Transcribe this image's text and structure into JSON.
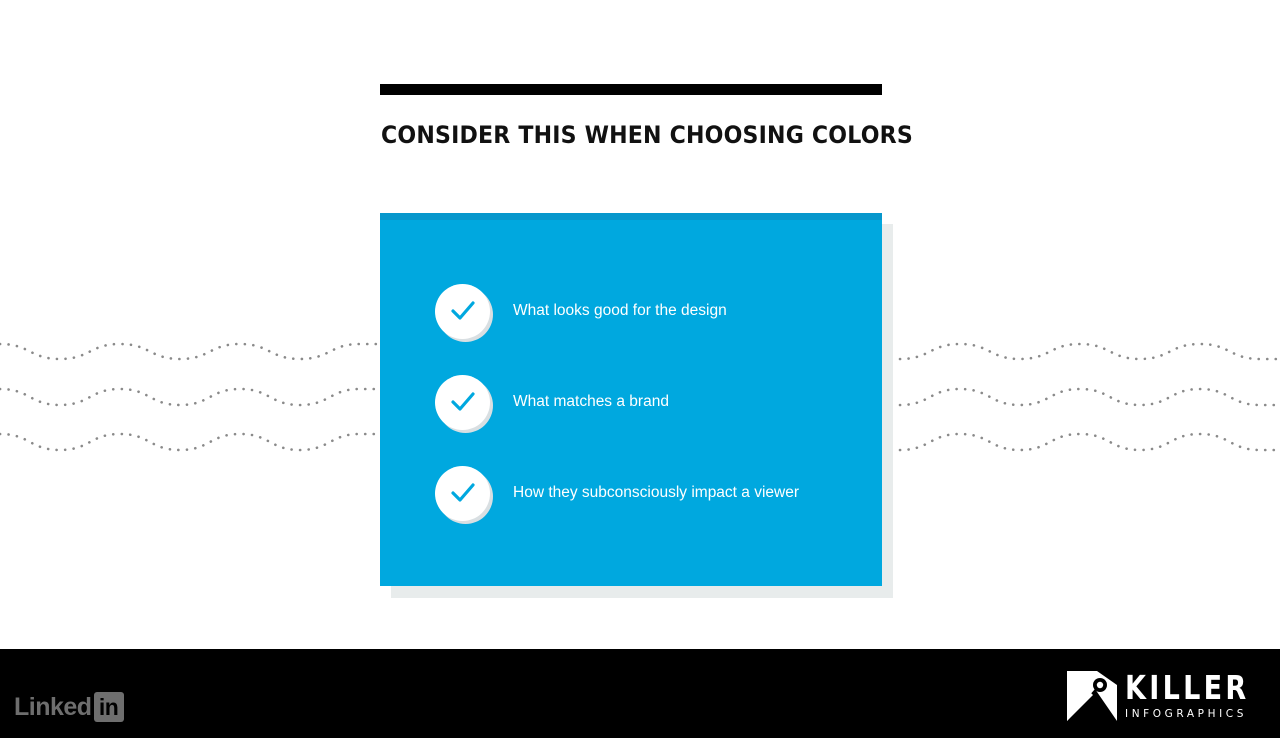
{
  "slide": {
    "title": "CONSIDER THIS WHEN CHOOSING COLORS",
    "card_color": "#00a8df",
    "items": [
      {
        "label": "What looks good for the design",
        "icon": "checkmark-icon"
      },
      {
        "label": "What matches a brand",
        "icon": "checkmark-icon"
      },
      {
        "label": "How they subconsciously impact a viewer",
        "icon": "checkmark-icon"
      }
    ]
  },
  "footer": {
    "linkedin_text": "Linked",
    "linkedin_box": "in",
    "brand_name": "KILLER",
    "brand_sub": "INFOGRAPHICS"
  }
}
